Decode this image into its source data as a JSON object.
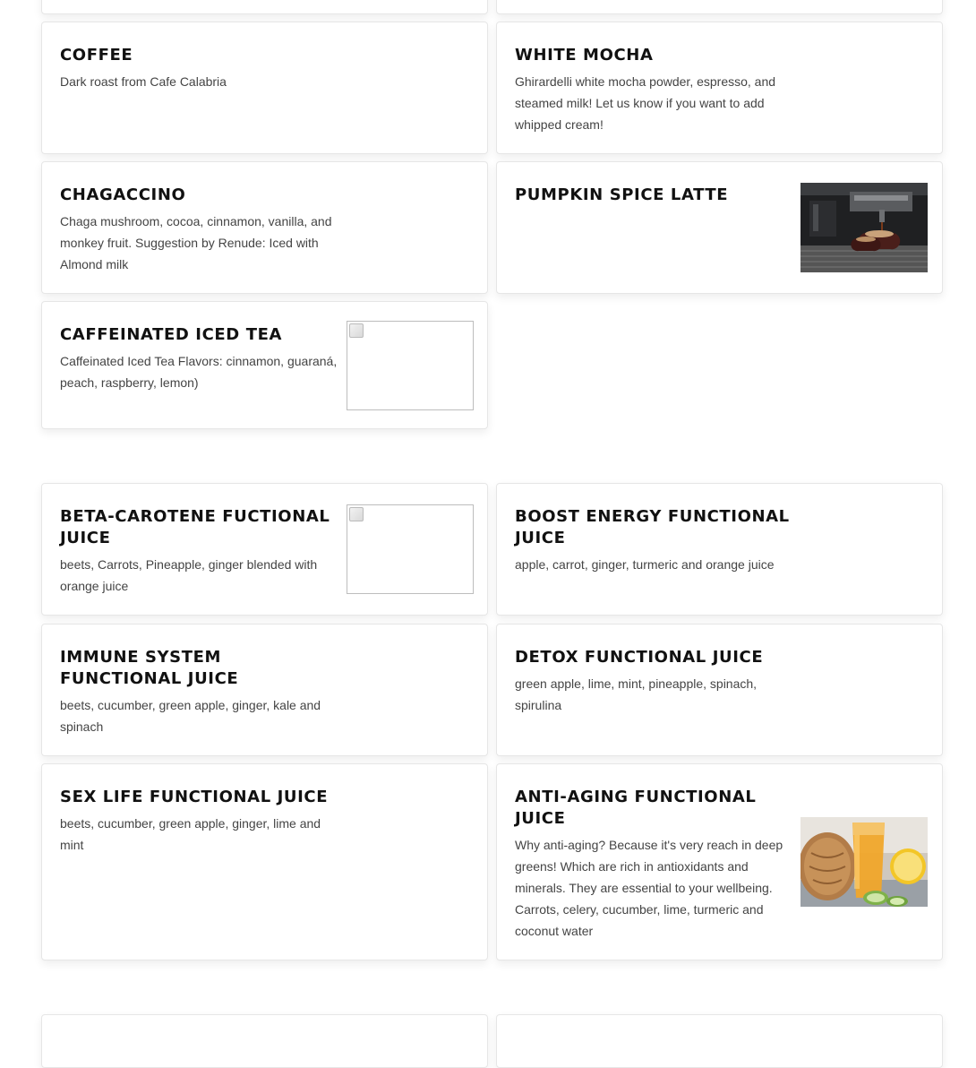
{
  "menu": {
    "coffee_section": [
      {
        "title": "COFFEE",
        "desc": "Dark roast from Cafe Calabria"
      },
      {
        "title": "WHITE MOCHA",
        "desc": "Ghirardelli white mocha powder, espresso, and steamed milk! Let us know if you want to add whipped cream!"
      },
      {
        "title": "CHAGACCINO",
        "desc": "Chaga mushroom, cocoa, cinnamon, vanilla, and monkey fruit. Suggestion by Renude: Iced with Almond milk"
      },
      {
        "title": "PUMPKIN SPICE LATTE",
        "desc": ""
      },
      {
        "title": "CAFFEINATED ICED TEA",
        "desc": "Caffeinated Iced Tea Flavors: cinnamon, guaraná, peach, raspberry, lemon)"
      }
    ],
    "juice_section": [
      {
        "title": "BETA-CAROTENE FUCTIONAL JUICE",
        "desc": "beets, Carrots, Pineapple, ginger blended with orange juice"
      },
      {
        "title": "BOOST ENERGY FUNCTIONAL JUICE",
        "desc": "apple, carrot, ginger, turmeric and orange juice"
      },
      {
        "title": "IMMUNE SYSTEM FUNCTIONAL JUICE",
        "desc": "beets, cucumber, green apple, ginger, kale and spinach"
      },
      {
        "title": "DETOX FUNCTIONAL JUICE",
        "desc": "green apple, lime, mint, pineapple, spinach, spirulina"
      },
      {
        "title": "SEX LIFE FUNCTIONAL JUICE",
        "desc": "beets, cucumber, green apple, ginger, lime and mint"
      },
      {
        "title": "ANTI-AGING FUNCTIONAL JUICE",
        "desc": "Why anti-aging? Because it's very reach in deep greens! Which are rich in antioxidants and minerals. They are essential to your wellbeing. Carrots, celery, cucumber, lime, turmeric and coconut water"
      }
    ]
  },
  "images": {
    "pumpkin_spice_latte": "espresso-machine-photo",
    "caffeinated_iced_tea": "broken-image",
    "beta_carotene": "broken-image",
    "anti_aging": "juice-glass-photo"
  }
}
